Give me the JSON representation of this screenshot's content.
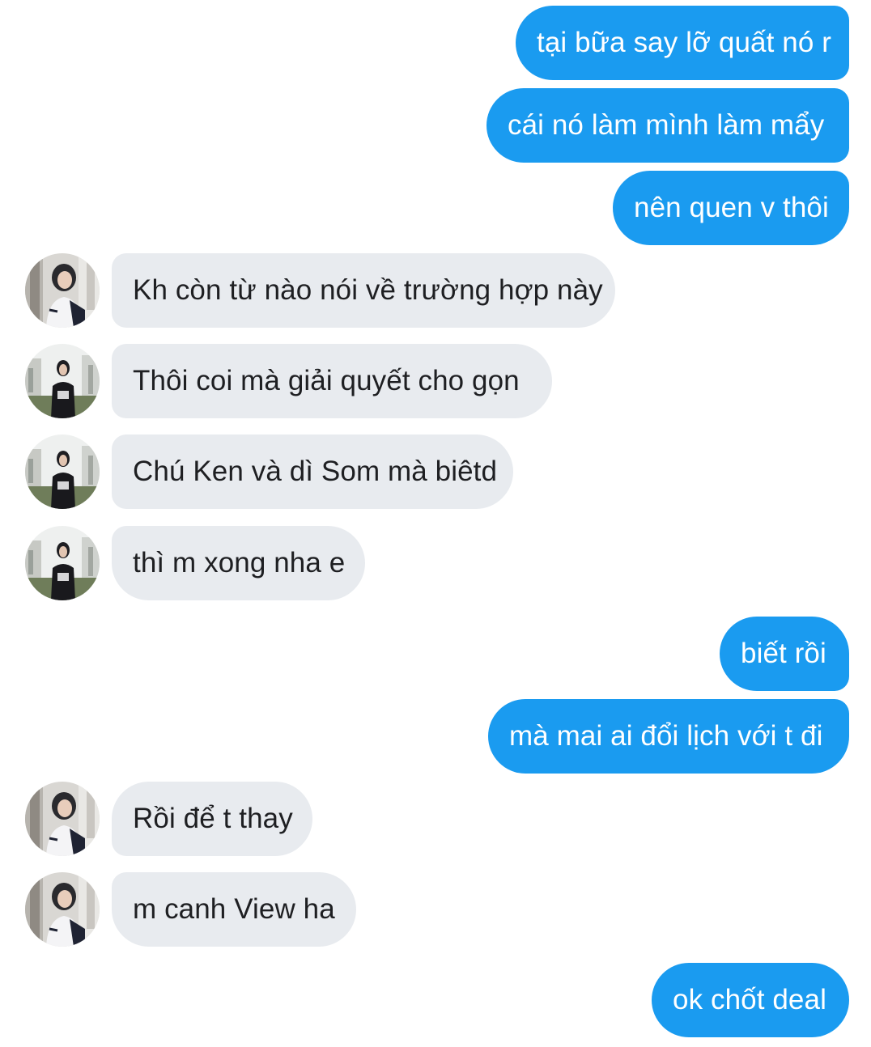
{
  "colors": {
    "outgoing_bubble": "#1a9bf0",
    "outgoing_text": "#ffffff",
    "incoming_bubble": "#e8ebef",
    "incoming_text": "#1e1f22"
  },
  "messages": [
    {
      "direction": "out",
      "text": "tại bữa say lỡ quất nó r"
    },
    {
      "direction": "out",
      "text": "cái nó làm mình làm mẩy"
    },
    {
      "direction": "out",
      "text": "nên quen v thôi"
    },
    {
      "direction": "in",
      "avatar": "avatar-photo-a",
      "text": "Kh còn từ nào nói về trường hợp này"
    },
    {
      "direction": "in",
      "avatar": "avatar-photo-b",
      "text": "Thôi coi mà giải quyết cho gọn"
    },
    {
      "direction": "in",
      "avatar": "avatar-photo-b",
      "text": "Chú Ken và dì Som mà biêtd"
    },
    {
      "direction": "in",
      "avatar": "avatar-photo-b",
      "text": "thì m xong nha e"
    },
    {
      "direction": "out",
      "text": "biết rồi"
    },
    {
      "direction": "out",
      "text": "mà mai ai đổi lịch với t đi"
    },
    {
      "direction": "in",
      "avatar": "avatar-photo-a",
      "text": "Rồi để t thay"
    },
    {
      "direction": "in",
      "avatar": "avatar-photo-a",
      "text": "m canh View ha"
    },
    {
      "direction": "out",
      "text": "ok chốt deal"
    }
  ]
}
